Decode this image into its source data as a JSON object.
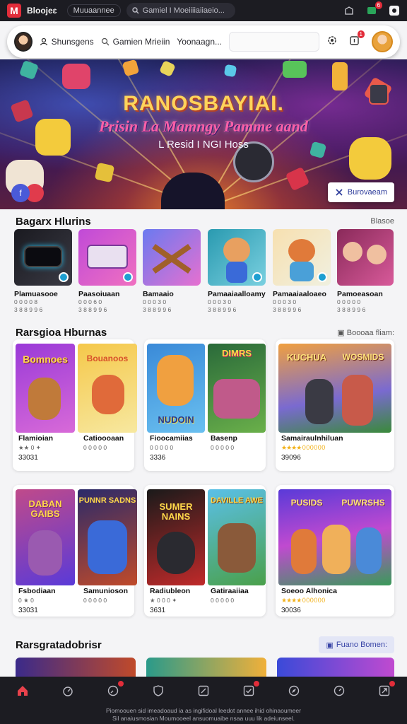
{
  "topbar": {
    "logo": "M",
    "brand": "Bloojeɛ",
    "tab": "Muuaannee",
    "search": "Gamiel I Moeiiiiaiiaeio...",
    "badge": "6"
  },
  "header": {
    "user_label": "Shunsgens",
    "search_label": "Gamien Mrieiin",
    "third_label": "Yoonaagn...",
    "input_placeholder": "",
    "notif_badge": "1"
  },
  "hero": {
    "title": "RANOSBAYIAI.",
    "subtitle": "Prisin La Mamngy Pamme aand",
    "tagline": "L Resid I NGI Hoss",
    "button_label": "Burovaeam",
    "corner_icon": "f"
  },
  "section1": {
    "title": "Bagarx Hlurins",
    "link": "Blasoe",
    "apps": [
      {
        "name": "Plamuasooe",
        "meta1": "0 0 0 0 8",
        "meta2": "3 8 8 9 9 6"
      },
      {
        "name": "Paasoiuaan",
        "meta1": "0 0 0 6 0",
        "meta2": "3 8 8 9 9 6"
      },
      {
        "name": "Bamaaio",
        "meta1": "0 0 0 3 0",
        "meta2": "3 8 8 9 9 6"
      },
      {
        "name": "Pamaaiaalloamy",
        "meta1": "0 0 0 3 0",
        "meta2": "3 8 8 9 9 6"
      },
      {
        "name": "Pamaaiaaloaeo",
        "meta1": "0 0 0 3 0",
        "meta2": "3 8 8 9 9 6"
      },
      {
        "name": "Pamoeasoan",
        "meta1": "0 0 0 0 0",
        "meta2": "3 8 8 9 9 6"
      }
    ]
  },
  "section2": {
    "title": "Rarsgioa Hburnas",
    "link": "Boooaa fliam:",
    "cards": [
      {
        "name": "Flamioian",
        "meta": "★★ 0 ✦",
        "num": "33031",
        "art_text": "Bomnoes"
      },
      {
        "name": "Catioooaan",
        "meta": "0 0 0 0 0",
        "num": "",
        "art_text": "Bouanoos"
      },
      {
        "name": "Fioocamiias",
        "meta": "0 0 0 0 0",
        "num": "3336",
        "art_text": "NUDOIN"
      },
      {
        "name": "Basenp",
        "meta": "0 0 0 0 0",
        "num": "",
        "art_text": "DIMRS"
      },
      {
        "name": "Samairaulnhiluan",
        "meta": "★★★★ 0 0 0 0 0 0",
        "num": "39096",
        "art_text": "KUCHUA",
        "art_text2": "WOSMIDS"
      }
    ]
  },
  "section3": {
    "cards": [
      {
        "name": "Fsbodiaan",
        "meta": "0 ★ 0",
        "num": "33031",
        "art_text": "DABAN GAIBS"
      },
      {
        "name": "Samunioson",
        "meta": "0 0 0 0 0",
        "num": "",
        "art_text": "PUNNR SADNS"
      },
      {
        "name": "Radiubleon",
        "meta": "★ 0 0 0 ✦",
        "num": "3631",
        "art_text": "SUMER NAINS"
      },
      {
        "name": "Gatiraaiiaa",
        "meta": "0 0 0 0 0",
        "num": "",
        "art_text": "DAVILLE AWE"
      },
      {
        "name": "Soeoo Alhonica",
        "meta": "★★★★ 0 0 0 0 0 0",
        "num": "30036",
        "art_text": "PUSIDS",
        "art_text2": "PUWRSHS"
      }
    ]
  },
  "section4": {
    "title": "Rarsgratadobrisr",
    "button_label": "Fuano Bomen:"
  },
  "bottomnav": {
    "items": [
      "home-icon",
      "timer-icon",
      "clock-icon",
      "shield-icon",
      "edit-icon",
      "check-icon",
      "compass-icon",
      "dial-icon",
      "share-icon"
    ]
  },
  "footer": {
    "line1": "Piomoouen sid imeadoaud ia as ingifidoal leedot annee ihid ohinaoumeer",
    "line2": "Sil anaiusmosian Moumooeel ansuomuaibe nsaa uuu lik adeiunseel."
  },
  "colors": {
    "accent": "#e22d3a",
    "dark": "#1c1c22",
    "link": "#3b47a8",
    "star": "#f2b21c"
  }
}
